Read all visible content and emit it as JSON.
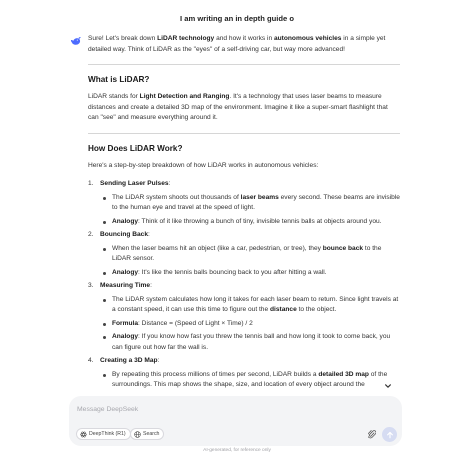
{
  "header": {
    "title": "I am writing an in depth guide o"
  },
  "message": {
    "intro": [
      {
        "t": "Sure! Let's break down ",
        "b": false
      },
      {
        "t": "LiDAR technology",
        "b": true
      },
      {
        "t": " and how it works in ",
        "b": false
      },
      {
        "t": "autonomous vehicles",
        "b": true
      },
      {
        "t": " in a simple yet detailed way. Think of LiDAR as the \"eyes\" of a self-driving car, but way more advanced!",
        "b": false
      }
    ],
    "section1_title": "What is LiDAR?",
    "section1_body": [
      {
        "t": "LiDAR stands for ",
        "b": false
      },
      {
        "t": "Light Detection and Ranging",
        "b": true
      },
      {
        "t": ". It's a technology that uses laser beams to measure distances and create a detailed 3D map of the environment. Imagine it like a super-smart flashlight that can \"see\" and measure everything around it.",
        "b": false
      }
    ],
    "section2_title": "How Does LiDAR Work?",
    "section2_intro": "Here's a step-by-step breakdown of how LiDAR works in autonomous vehicles:",
    "steps": [
      {
        "num": "1.",
        "title": "Sending Laser Pulses",
        "suffix": ":",
        "bullets": [
          [
            {
              "t": "The LiDAR system shoots out thousands of ",
              "b": false
            },
            {
              "t": "laser beams",
              "b": true
            },
            {
              "t": " every second. These beams are invisible to the human eye and travel at the speed of light.",
              "b": false
            }
          ],
          [
            {
              "t": "Analogy",
              "b": true
            },
            {
              "t": ": Think of it like throwing a bunch of tiny, invisible tennis balls at objects around you.",
              "b": false
            }
          ]
        ]
      },
      {
        "num": "2.",
        "title": "Bouncing Back",
        "suffix": ":",
        "bullets": [
          [
            {
              "t": "When the laser beams hit an object (like a car, pedestrian, or tree), they ",
              "b": false
            },
            {
              "t": "bounce back",
              "b": true
            },
            {
              "t": " to the LiDAR sensor.",
              "b": false
            }
          ],
          [
            {
              "t": "Analogy",
              "b": true
            },
            {
              "t": ": It's like the tennis balls bouncing back to you after hitting a wall.",
              "b": false
            }
          ]
        ]
      },
      {
        "num": "3.",
        "title": "Measuring Time",
        "suffix": ":",
        "bullets": [
          [
            {
              "t": "The LiDAR system calculates how long it takes for each laser beam to return. Since light travels at a constant speed, it can use this time to figure out the ",
              "b": false
            },
            {
              "t": "distance",
              "b": true
            },
            {
              "t": " to the object.",
              "b": false
            }
          ],
          [
            {
              "t": "Formula",
              "b": true
            },
            {
              "t": ": Distance = (Speed of Light × Time) / 2",
              "b": false
            }
          ],
          [
            {
              "t": "Analogy",
              "b": true
            },
            {
              "t": ": If you know how fast you threw the tennis ball and how long it took to come back, you can figure out how far the wall is.",
              "b": false
            }
          ]
        ]
      },
      {
        "num": "4.",
        "title": "Creating a 3D Map",
        "suffix": ":",
        "bullets": [
          [
            {
              "t": "By repeating this process millions of times per second, LiDAR builds a ",
              "b": false
            },
            {
              "t": "detailed 3D map",
              "b": true
            },
            {
              "t": " of the surroundings. This map shows the shape, size, and location of every object around the",
              "b": false
            }
          ]
        ]
      }
    ]
  },
  "composer": {
    "placeholder": "Message DeepSeek",
    "deepthink_label": "DeepThink (R1)",
    "search_label": "Search"
  },
  "footer": {
    "note": "AI-generated, for reference only"
  },
  "icons": {
    "logo": "deepseek-whale-icon",
    "scroll": "chevron-down-icon",
    "deepthink": "atom-icon",
    "search": "globe-icon",
    "attach": "paperclip-icon",
    "send": "arrow-up-icon"
  },
  "colors": {
    "accent": "#4d6bfe",
    "send_disabled": "#d6dcf2",
    "composer_bg": "#f3f4f6"
  }
}
